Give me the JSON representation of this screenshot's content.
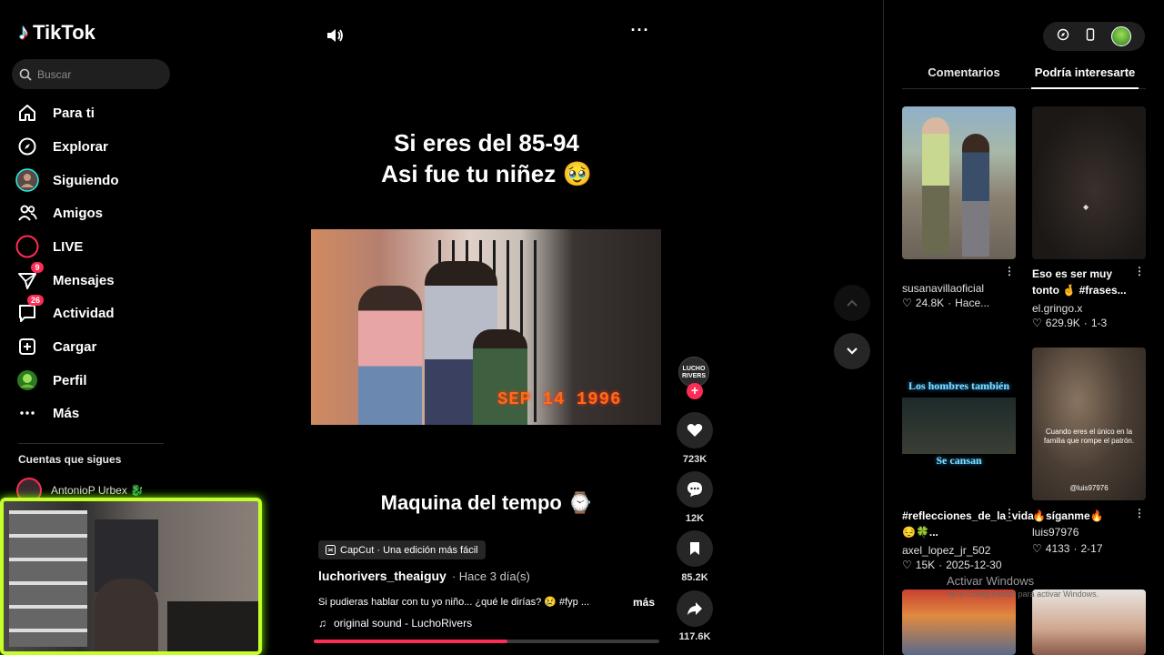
{
  "app": {
    "name": "TikTok"
  },
  "search": {
    "placeholder": "Buscar"
  },
  "nav": [
    {
      "label": "Para ti",
      "icon": "home-icon"
    },
    {
      "label": "Explorar",
      "icon": "compass-icon"
    },
    {
      "label": "Siguiendo",
      "icon": "following-avatar-icon"
    },
    {
      "label": "Amigos",
      "icon": "friends-icon"
    },
    {
      "label": "LIVE",
      "icon": "live-icon"
    },
    {
      "label": "Mensajes",
      "icon": "messages-icon",
      "badge": "9"
    },
    {
      "label": "Actividad",
      "icon": "activity-icon",
      "badge": "26"
    },
    {
      "label": "Cargar",
      "icon": "upload-icon"
    },
    {
      "label": "Perfil",
      "icon": "profile-avatar-icon"
    },
    {
      "label": "Más",
      "icon": "more-dots-icon"
    }
  ],
  "following": {
    "title": "Cuentas que sigues",
    "users": [
      {
        "name": "AntonioP Urbex 🐉"
      }
    ]
  },
  "video": {
    "headline_line1": "Si eres del 85-94",
    "headline_line2": "Asi fue tu niñez 🥹",
    "date_stamp": "SEP 14 1996",
    "subtitle": "Maquina del tempo ⌚",
    "capcut_label": "CapCut · Una edición más fácil",
    "author": "luchorivers_theaiguy",
    "posted": "· Hace 3 día(s)",
    "caption": "Si pudieras hablar con tu yo niño... ¿qué le dirías? 😢 #fyp ...",
    "more_label": "más",
    "music": "original sound - LuchoRivers",
    "progress": 0.56,
    "creator_avatar_text": "LUCHO RIVERS"
  },
  "actions": {
    "likes": "723K",
    "comments": "12K",
    "saves": "85.2K",
    "shares": "117.6K"
  },
  "panel": {
    "tabs": [
      "Comentarios",
      "Podría interesarte"
    ],
    "active_tab": "Podría interesarte",
    "items": [
      {
        "title": "",
        "user": "susanavillaoficial",
        "likes": "24.8K",
        "time": "Hace..."
      },
      {
        "title": "Eso es ser muy tonto 🤞 #frases...",
        "user": "el.gringo.x",
        "likes": "629.9K",
        "time": "1-3"
      },
      {
        "title": "#reflecciones_de_la_vida😔🍀...",
        "user": "axel_lopez_jr_502",
        "likes": "15K",
        "time": "2025-12-30",
        "thumb_text_top": "Los hombres también",
        "thumb_text_bottom": "Se cansan"
      },
      {
        "title": "🔥síganme🔥",
        "user": "luis97976",
        "likes": "4133",
        "time": "2-17",
        "thumb_text": "Cuando eres el único en la familia que rompe el patrón.",
        "thumb_handle": "@luis97976"
      }
    ]
  },
  "watermark": {
    "line1": "Activar Windows",
    "line2": "Ve a Configuración para activar Windows."
  },
  "colors": {
    "accent": "#fe2c55",
    "webcam_border": "#c5ff2a",
    "date_stamp": "#ff6a1a"
  }
}
